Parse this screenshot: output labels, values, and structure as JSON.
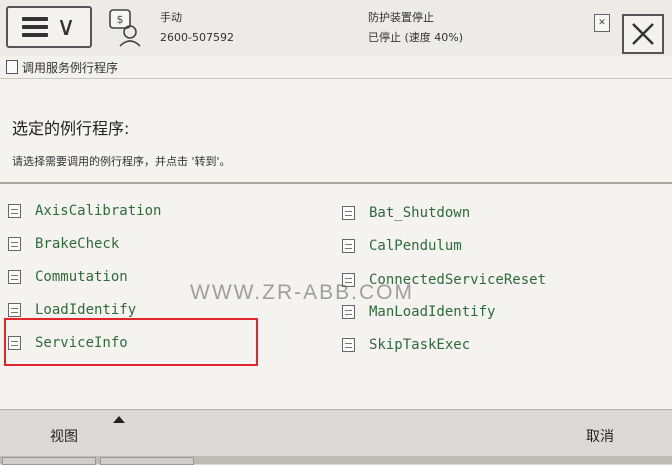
{
  "header": {
    "mode": "手动",
    "controller_id": "2600-507592",
    "safety_status": "防护装置停止",
    "motor_status": "已停止 (速度 40%)"
  },
  "title_bar": {
    "title": "调用服务例行程序"
  },
  "main": {
    "heading": "选定的例行程序:",
    "instruction": "请选择需要调用的例行程序，并点击 '转到'。",
    "left_column": [
      {
        "label": "AxisCalibration"
      },
      {
        "label": "BrakeCheck"
      },
      {
        "label": "Commutation"
      },
      {
        "label": "LoadIdentify"
      },
      {
        "label": "ServiceInfo"
      }
    ],
    "right_column": [
      {
        "label": "Bat_Shutdown"
      },
      {
        "label": "CalPendulum"
      },
      {
        "label": "ConnectedServiceReset"
      },
      {
        "label": "ManLoadIdentify"
      },
      {
        "label": "SkipTaskExec"
      }
    ],
    "selected": "ServiceInfo"
  },
  "watermark": "WWW.ZR-ABB.COM",
  "footer": {
    "view_label": "视图",
    "cancel_label": "取消"
  },
  "colors": {
    "item_text": "#2f6a3c",
    "highlight": "#e0262a"
  },
  "icons": [
    "hamburger-menu-icon",
    "chevron-down-icon",
    "robot-status-icon",
    "close-icon",
    "routine-document-icon",
    "arrow-up-icon"
  ]
}
